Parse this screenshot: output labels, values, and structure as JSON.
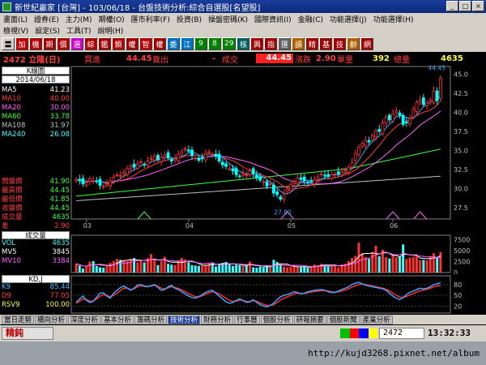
{
  "window": {
    "title": "新世紀贏家 [台灣] - 103/06/18 - 台盤技術分析:綜合自選股[名望股]"
  },
  "menu": {
    "row1": [
      "畫面(L)",
      "證券(E)",
      "主力(M)",
      "期權(O)",
      "匯市利率(F)",
      "投資(B)",
      "操盤密碼(K)",
      "國際資訊(I)",
      "金融(C)",
      "功能選擇(J)",
      "功能選擇(H)"
    ],
    "row2": [
      "檢視(V)",
      "設定(S)",
      "工具(T)",
      "說明(H)"
    ]
  },
  "toolbar": [
    "〓",
    "加",
    "機",
    "期",
    "價",
    "選",
    "綜",
    "鑑",
    "類",
    "權",
    "智",
    "權",
    "委",
    "江",
    "9",
    "8",
    "29",
    "核",
    "興",
    "指",
    "匯",
    "讀",
    "精",
    "基",
    "技",
    "齡",
    "網"
  ],
  "info": {
    "code_name": "2472 立隆(日)",
    "buy_label": "買進",
    "buy_value": "44.45",
    "sell_label": "賣出",
    "sell_value": "-",
    "trade_label": "成交",
    "trade_value": "44.45",
    "change_label": "漲跌",
    "change_value": "2.90",
    "qty_label": "單量",
    "qty_value": "392",
    "volume_label": "總量",
    "volume_value": "4635"
  },
  "kline": {
    "panel_label": "K線圖",
    "date": "2014/06/18",
    "ma": [
      {
        "name": "MA5",
        "value": "41.23",
        "color": "#ffffff"
      },
      {
        "name": "MA10",
        "value": "40.00",
        "color": "#ff4040"
      },
      {
        "name": "MA20",
        "value": "30.00",
        "color": "#ff60ff"
      },
      {
        "name": "MA60",
        "value": "33.78",
        "color": "#40ff40"
      },
      {
        "name": "MA108",
        "value": "31.97",
        "color": "#c0c0c0"
      },
      {
        "name": "MA240",
        "value": "26.08",
        "color": "#40ffff"
      }
    ],
    "prices": [
      {
        "name": "開盤價",
        "value": "41.90"
      },
      {
        "name": "最高價",
        "value": "44.45"
      },
      {
        "name": "最低價",
        "value": "41.85"
      },
      {
        "name": "收盤價",
        "value": "44.45"
      },
      {
        "name": "成交量",
        "value": "4635"
      },
      {
        "name": "差",
        "value": "2.90"
      }
    ],
    "high_label": "44.45",
    "low_label": "27.80",
    "y_ticks": [
      "45.0",
      "42.5",
      "40.0",
      "37.5",
      "35.0",
      "32.5",
      "30.0",
      "27.5"
    ],
    "x_ticks": [
      "03",
      "04",
      "05",
      "06"
    ],
    "closes": [
      31.2,
      31.0,
      30.6,
      30.8,
      31.3,
      31.0,
      30.9,
      30.4,
      30.3,
      30.6,
      31.0,
      31.5,
      31.8,
      31.7,
      32.1,
      32.6,
      32.9,
      32.8,
      33.2,
      33.5,
      33.1,
      33.6,
      33.9,
      34.2,
      33.8,
      34.1,
      34.4,
      34.0,
      33.6,
      33.9,
      34.5,
      34.8,
      35.2,
      34.9,
      34.3,
      34.0,
      33.7,
      33.9,
      34.6,
      34.8,
      34.5,
      34.2,
      33.6,
      33.1,
      32.9,
      32.6,
      32.3,
      31.8,
      31.6,
      32.0,
      31.8,
      32.3,
      31.9,
      31.4,
      31.1,
      30.9,
      30.3,
      30.6,
      29.4,
      29.2,
      28.6,
      29.3,
      29.9,
      30.5,
      30.9,
      31.4,
      31.2,
      31.0,
      30.8,
      30.9,
      31.2,
      31.5,
      31.9,
      31.7,
      31.6,
      31.8,
      31.9,
      31.9,
      32.2,
      32.4,
      32.8,
      33.4,
      34.6,
      35.4,
      35.9,
      36.3,
      36.1,
      36.9,
      37.6,
      37.5,
      38.6,
      39.3,
      39.0,
      39.8,
      40.2,
      39.6,
      38.4,
      38.6,
      39.2,
      40.4,
      41.3,
      41.6,
      41.0,
      41.2,
      41.6,
      42.8,
      41.5,
      44.45
    ]
  },
  "volume": {
    "label": "成交量",
    "vol": {
      "name": "VOL",
      "value": "4635"
    },
    "mv5": {
      "name": "MV5",
      "value": "3845"
    },
    "mv10": {
      "name": "MV10",
      "value": "3384"
    },
    "y_ticks": [
      "7500",
      "5000",
      "2500",
      "0"
    ],
    "values": [
      2000,
      1600,
      900,
      1400,
      2500,
      2600,
      1500,
      1200,
      1100,
      1800,
      2200,
      2600,
      3100,
      2900,
      2800,
      2600,
      3100,
      3300,
      2300,
      2700,
      2300,
      3300,
      4200,
      2800,
      1700,
      2600,
      3600,
      2000,
      1800,
      1700,
      2600,
      3300,
      3000,
      2300,
      1700,
      1600,
      1500,
      1600,
      1800,
      2100,
      2300,
      1400,
      2000,
      2200,
      2400,
      1900,
      1500,
      1800,
      1700,
      1500,
      1600,
      2500,
      1200,
      1100,
      1400,
      1300,
      1600,
      1200,
      2900,
      2400,
      1800,
      1300,
      1200,
      1400,
      1500,
      1300,
      1200,
      1300,
      1100,
      1500,
      1800,
      1600,
      2000,
      1700,
      1500,
      1600,
      1700,
      1200,
      1800,
      2000,
      2600,
      3300,
      3800,
      6800,
      4400,
      3500,
      3100,
      4600,
      6100,
      3700,
      5200,
      3500,
      3200,
      4000,
      3500,
      3700,
      6400,
      3100,
      3400,
      3500,
      3700,
      2800,
      2900,
      2800,
      3700,
      4400,
      3500,
      4635
    ]
  },
  "kdj": {
    "label": "KD,J",
    "k": {
      "name": "K9",
      "value": "85.44"
    },
    "d": {
      "name": "D9",
      "value": "77.05"
    },
    "rsv": {
      "name": "RSV9",
      "value": "100.00"
    },
    "y_ticks": [
      "80",
      "50",
      "20"
    ],
    "k_values": [
      30,
      40,
      48,
      36,
      30,
      33,
      45,
      56,
      57,
      48,
      42,
      56,
      64,
      72,
      76,
      70,
      64,
      70,
      79,
      80,
      75,
      74,
      77,
      80,
      72,
      64,
      66,
      74,
      78,
      70,
      66,
      60,
      54,
      48,
      44,
      42,
      46,
      52,
      58,
      62,
      64,
      56,
      48,
      40,
      32,
      28,
      30,
      36,
      40,
      35,
      30,
      32,
      38,
      30,
      24,
      20,
      18,
      22,
      28,
      38,
      46,
      50,
      52,
      56,
      60,
      58,
      54,
      56,
      60,
      62,
      64,
      65,
      66,
      64,
      60,
      58,
      58,
      62,
      66,
      70,
      74,
      80,
      84,
      86,
      82,
      78,
      76,
      74,
      72,
      70,
      68,
      64,
      56,
      48,
      42,
      38,
      44,
      52,
      58,
      62,
      66,
      70,
      68,
      70,
      74,
      80,
      82,
      85.44
    ],
    "d_values": [
      28,
      34,
      40,
      38,
      34,
      34,
      40,
      48,
      52,
      50,
      46,
      50,
      56,
      64,
      70,
      70,
      66,
      68,
      74,
      77,
      76,
      75,
      76,
      78,
      75,
      70,
      68,
      71,
      74,
      72,
      69,
      65,
      60,
      55,
      50,
      46,
      46,
      49,
      53,
      57,
      60,
      58,
      54,
      48,
      42,
      36,
      33,
      34,
      37,
      36,
      33,
      33,
      35,
      33,
      29,
      25,
      22,
      22,
      24,
      30,
      37,
      42,
      46,
      50,
      54,
      56,
      55,
      55,
      57,
      59,
      61,
      62,
      63,
      63,
      62,
      60,
      59,
      60,
      62,
      65,
      68,
      73,
      77,
      80,
      81,
      80,
      78,
      76,
      74,
      72,
      70,
      67,
      62,
      56,
      50,
      45,
      44,
      47,
      51,
      55,
      59,
      63,
      65,
      67,
      70,
      74,
      76,
      77.05
    ]
  },
  "tabs": [
    "當日走勢",
    "橫向分析",
    "深度分析",
    "基本分析",
    "籌碼分析",
    "技術分析",
    "財務分析",
    "行事曆",
    "個股分析",
    "研報摘要",
    "個股新聞",
    "產業分析"
  ],
  "active_tab": "技術分析",
  "status": {
    "label": "精鈍",
    "code": "2472",
    "time": "13:32:33"
  },
  "watermark": "http://kujd3268.pixnet.net/album",
  "colors": {
    "up": "#ff3030",
    "down": "#00ffff",
    "accent": "#0000ff"
  }
}
